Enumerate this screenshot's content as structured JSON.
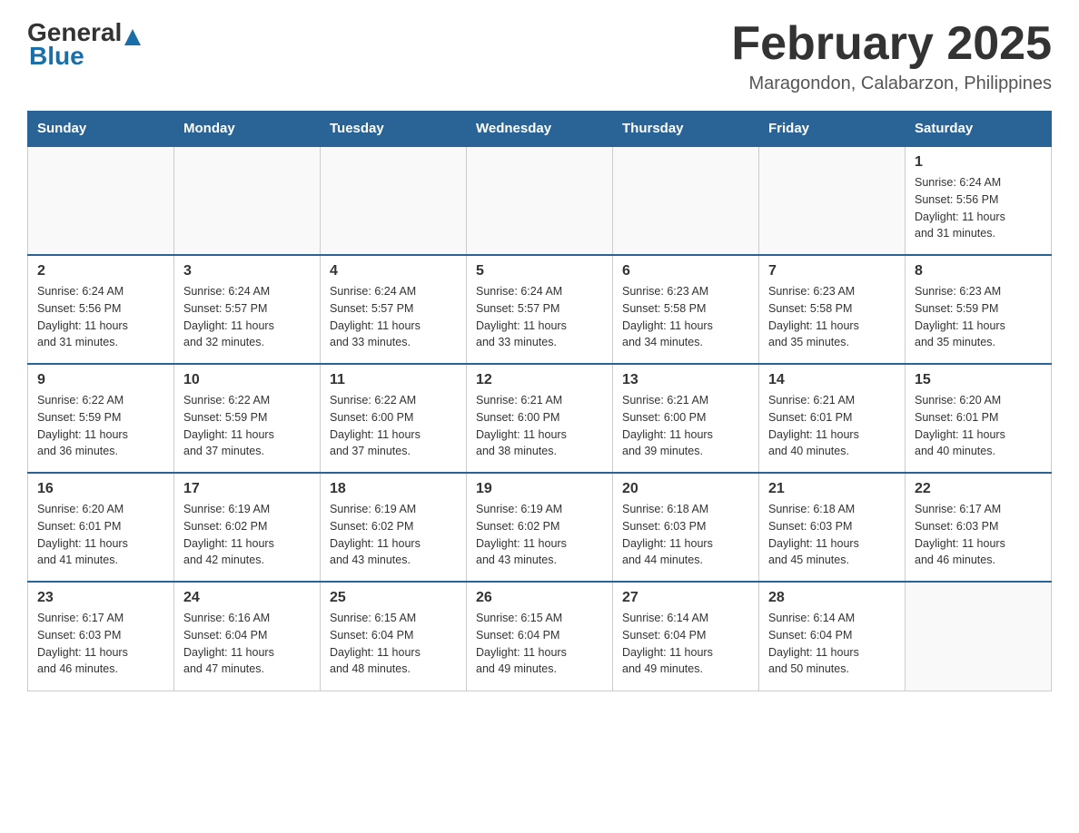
{
  "header": {
    "logo_general": "General",
    "logo_blue": "Blue",
    "title": "February 2025",
    "subtitle": "Maragondon, Calabarzon, Philippines"
  },
  "calendar": {
    "days_of_week": [
      "Sunday",
      "Monday",
      "Tuesday",
      "Wednesday",
      "Thursday",
      "Friday",
      "Saturday"
    ],
    "weeks": [
      [
        {
          "day": "",
          "info": "",
          "empty": true
        },
        {
          "day": "",
          "info": "",
          "empty": true
        },
        {
          "day": "",
          "info": "",
          "empty": true
        },
        {
          "day": "",
          "info": "",
          "empty": true
        },
        {
          "day": "",
          "info": "",
          "empty": true
        },
        {
          "day": "",
          "info": "",
          "empty": true
        },
        {
          "day": "1",
          "info": "Sunrise: 6:24 AM\nSunset: 5:56 PM\nDaylight: 11 hours\nand 31 minutes."
        }
      ],
      [
        {
          "day": "2",
          "info": "Sunrise: 6:24 AM\nSunset: 5:56 PM\nDaylight: 11 hours\nand 31 minutes."
        },
        {
          "day": "3",
          "info": "Sunrise: 6:24 AM\nSunset: 5:57 PM\nDaylight: 11 hours\nand 32 minutes."
        },
        {
          "day": "4",
          "info": "Sunrise: 6:24 AM\nSunset: 5:57 PM\nDaylight: 11 hours\nand 33 minutes."
        },
        {
          "day": "5",
          "info": "Sunrise: 6:24 AM\nSunset: 5:57 PM\nDaylight: 11 hours\nand 33 minutes."
        },
        {
          "day": "6",
          "info": "Sunrise: 6:23 AM\nSunset: 5:58 PM\nDaylight: 11 hours\nand 34 minutes."
        },
        {
          "day": "7",
          "info": "Sunrise: 6:23 AM\nSunset: 5:58 PM\nDaylight: 11 hours\nand 35 minutes."
        },
        {
          "day": "8",
          "info": "Sunrise: 6:23 AM\nSunset: 5:59 PM\nDaylight: 11 hours\nand 35 minutes."
        }
      ],
      [
        {
          "day": "9",
          "info": "Sunrise: 6:22 AM\nSunset: 5:59 PM\nDaylight: 11 hours\nand 36 minutes."
        },
        {
          "day": "10",
          "info": "Sunrise: 6:22 AM\nSunset: 5:59 PM\nDaylight: 11 hours\nand 37 minutes."
        },
        {
          "day": "11",
          "info": "Sunrise: 6:22 AM\nSunset: 6:00 PM\nDaylight: 11 hours\nand 37 minutes."
        },
        {
          "day": "12",
          "info": "Sunrise: 6:21 AM\nSunset: 6:00 PM\nDaylight: 11 hours\nand 38 minutes."
        },
        {
          "day": "13",
          "info": "Sunrise: 6:21 AM\nSunset: 6:00 PM\nDaylight: 11 hours\nand 39 minutes."
        },
        {
          "day": "14",
          "info": "Sunrise: 6:21 AM\nSunset: 6:01 PM\nDaylight: 11 hours\nand 40 minutes."
        },
        {
          "day": "15",
          "info": "Sunrise: 6:20 AM\nSunset: 6:01 PM\nDaylight: 11 hours\nand 40 minutes."
        }
      ],
      [
        {
          "day": "16",
          "info": "Sunrise: 6:20 AM\nSunset: 6:01 PM\nDaylight: 11 hours\nand 41 minutes."
        },
        {
          "day": "17",
          "info": "Sunrise: 6:19 AM\nSunset: 6:02 PM\nDaylight: 11 hours\nand 42 minutes."
        },
        {
          "day": "18",
          "info": "Sunrise: 6:19 AM\nSunset: 6:02 PM\nDaylight: 11 hours\nand 43 minutes."
        },
        {
          "day": "19",
          "info": "Sunrise: 6:19 AM\nSunset: 6:02 PM\nDaylight: 11 hours\nand 43 minutes."
        },
        {
          "day": "20",
          "info": "Sunrise: 6:18 AM\nSunset: 6:03 PM\nDaylight: 11 hours\nand 44 minutes."
        },
        {
          "day": "21",
          "info": "Sunrise: 6:18 AM\nSunset: 6:03 PM\nDaylight: 11 hours\nand 45 minutes."
        },
        {
          "day": "22",
          "info": "Sunrise: 6:17 AM\nSunset: 6:03 PM\nDaylight: 11 hours\nand 46 minutes."
        }
      ],
      [
        {
          "day": "23",
          "info": "Sunrise: 6:17 AM\nSunset: 6:03 PM\nDaylight: 11 hours\nand 46 minutes."
        },
        {
          "day": "24",
          "info": "Sunrise: 6:16 AM\nSunset: 6:04 PM\nDaylight: 11 hours\nand 47 minutes."
        },
        {
          "day": "25",
          "info": "Sunrise: 6:15 AM\nSunset: 6:04 PM\nDaylight: 11 hours\nand 48 minutes."
        },
        {
          "day": "26",
          "info": "Sunrise: 6:15 AM\nSunset: 6:04 PM\nDaylight: 11 hours\nand 49 minutes."
        },
        {
          "day": "27",
          "info": "Sunrise: 6:14 AM\nSunset: 6:04 PM\nDaylight: 11 hours\nand 49 minutes."
        },
        {
          "day": "28",
          "info": "Sunrise: 6:14 AM\nSunset: 6:04 PM\nDaylight: 11 hours\nand 50 minutes."
        },
        {
          "day": "",
          "info": "",
          "empty": true
        }
      ]
    ]
  }
}
